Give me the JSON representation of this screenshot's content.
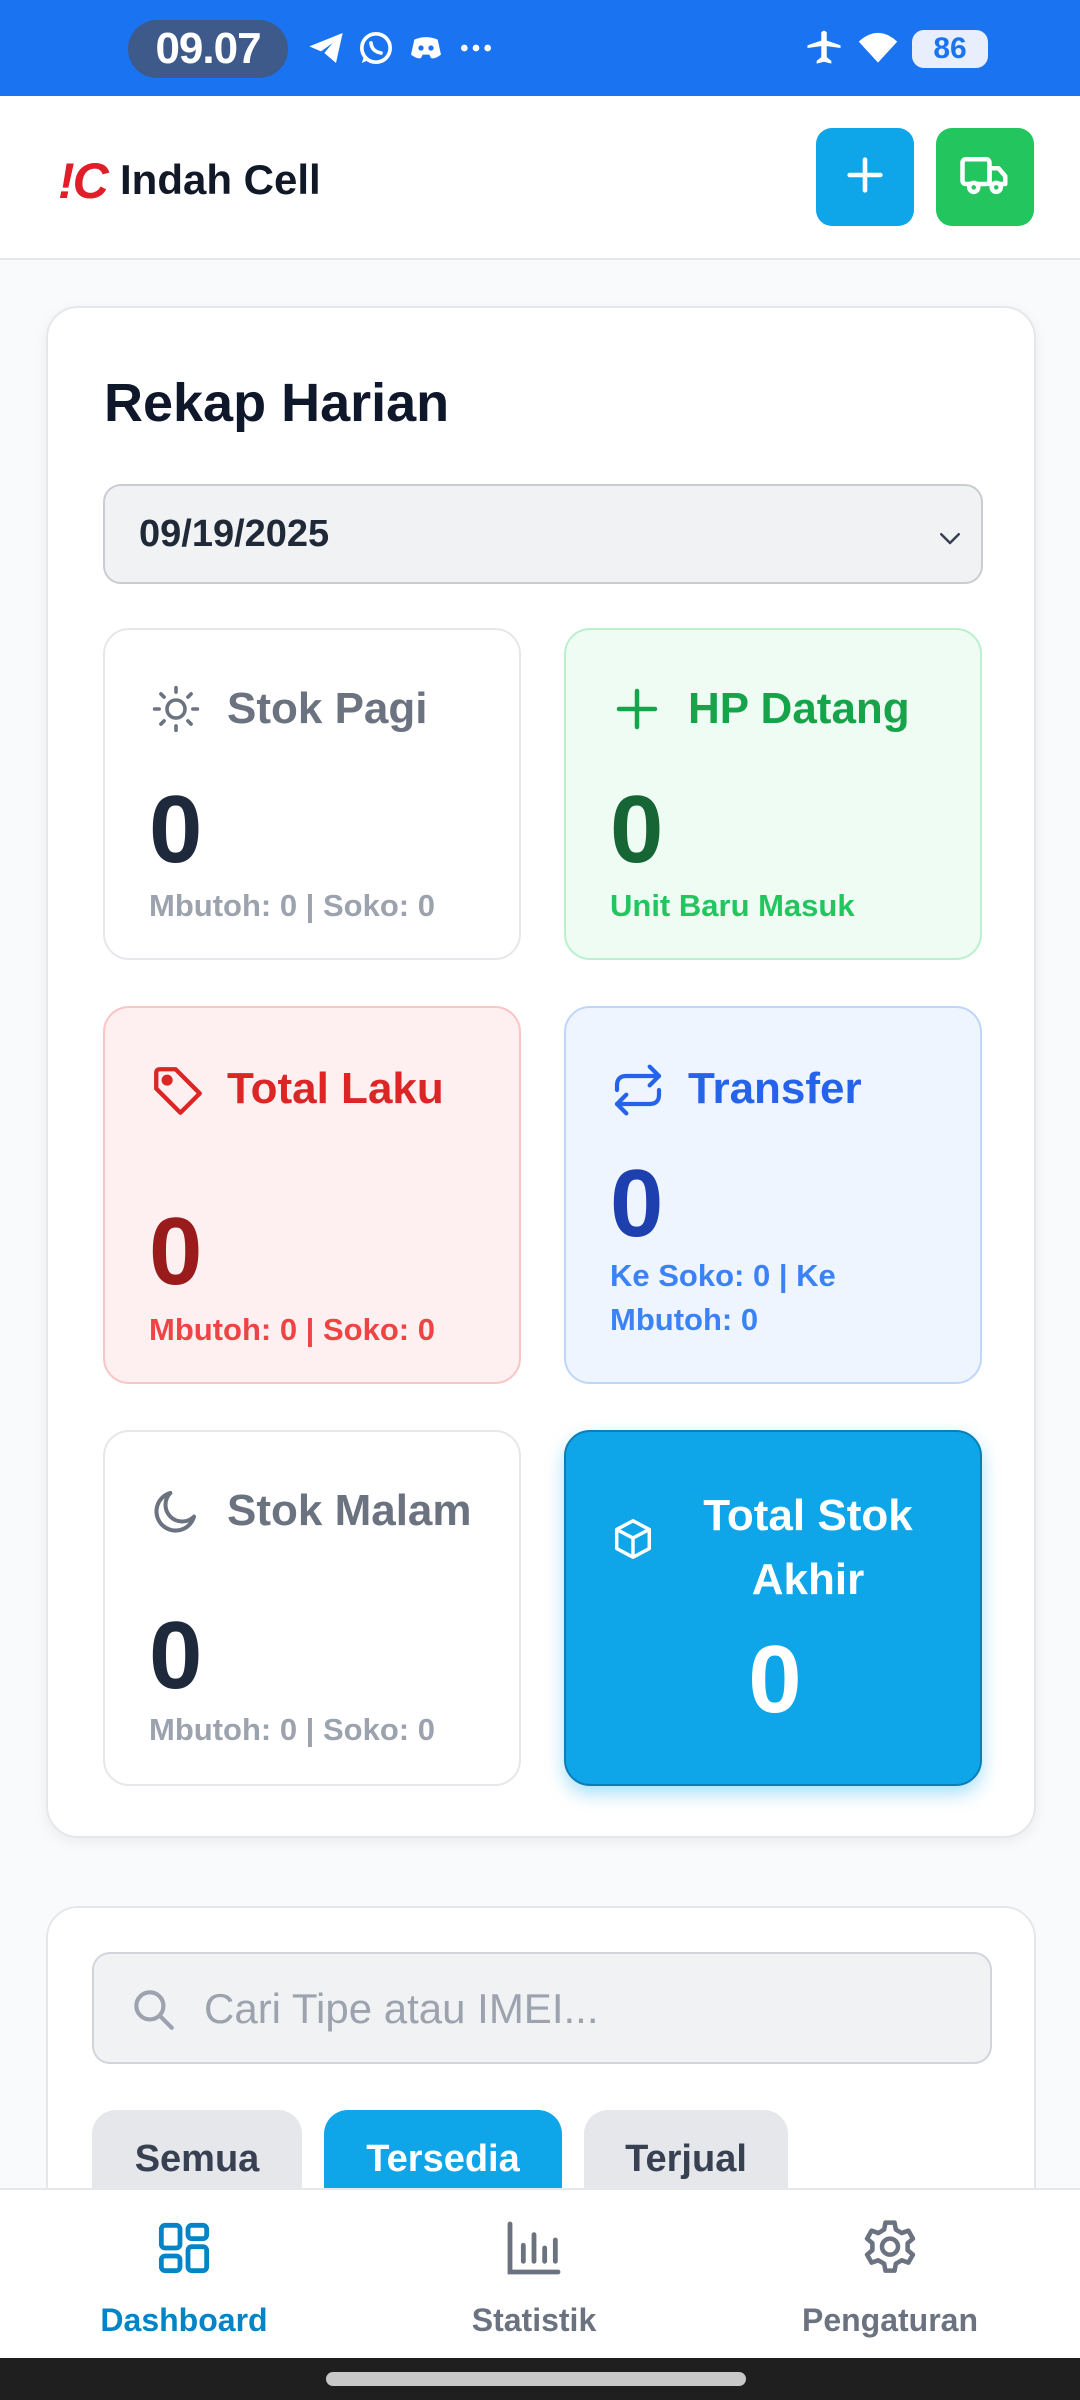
{
  "status_bar": {
    "time": "09.07",
    "battery": "86",
    "icons": [
      "telegram-icon",
      "whatsapp-icon",
      "discord-icon",
      "more-icon",
      "airplane-icon",
      "wifi-icon",
      "battery-icon"
    ]
  },
  "header": {
    "logo_mark": "!C",
    "logo_text": "Indah Cell",
    "add_icon": "plus-icon",
    "delivery_icon": "truck-icon"
  },
  "recap": {
    "title": "Rekap Harian",
    "date": "09/19/2025",
    "cards": {
      "morning": {
        "label": "Stok Pagi",
        "value": "0",
        "sub": "Mbutoh: 0 | Soko: 0",
        "icon": "sun-icon"
      },
      "incoming": {
        "label": "HP Datang",
        "value": "0",
        "sub": "Unit Baru Masuk",
        "icon": "plus-icon"
      },
      "sold": {
        "label": "Total Laku",
        "value": "0",
        "sub": "Mbutoh: 0 | Soko: 0",
        "icon": "tag-icon"
      },
      "transfer": {
        "label": "Transfer",
        "value": "0",
        "sub": "Ke Soko: 0 | Ke Mbutoh: 0",
        "icon": "repeat-icon"
      },
      "night": {
        "label": "Stok Malam",
        "value": "0",
        "sub": "Mbutoh: 0 | Soko: 0",
        "icon": "moon-icon"
      },
      "total": {
        "label": "Total Stok Akhir",
        "value": "0",
        "icon": "box-icon"
      }
    }
  },
  "search": {
    "placeholder": "Cari Tipe atau IMEI...",
    "value": "",
    "filters": [
      "Semua",
      "Tersedia",
      "Terjual"
    ],
    "active_filter": "Tersedia"
  },
  "bottom_nav": {
    "items": [
      {
        "label": "Dashboard",
        "icon": "dashboard-icon",
        "active": true
      },
      {
        "label": "Statistik",
        "icon": "bar-chart-icon",
        "active": false
      },
      {
        "label": "Pengaturan",
        "icon": "gear-icon",
        "active": false
      }
    ]
  },
  "colors": {
    "status_bar": "#1a73f0",
    "primary": "#0ea5e9",
    "success": "#22c55e",
    "danger": "#dc2626",
    "info": "#2563eb"
  }
}
